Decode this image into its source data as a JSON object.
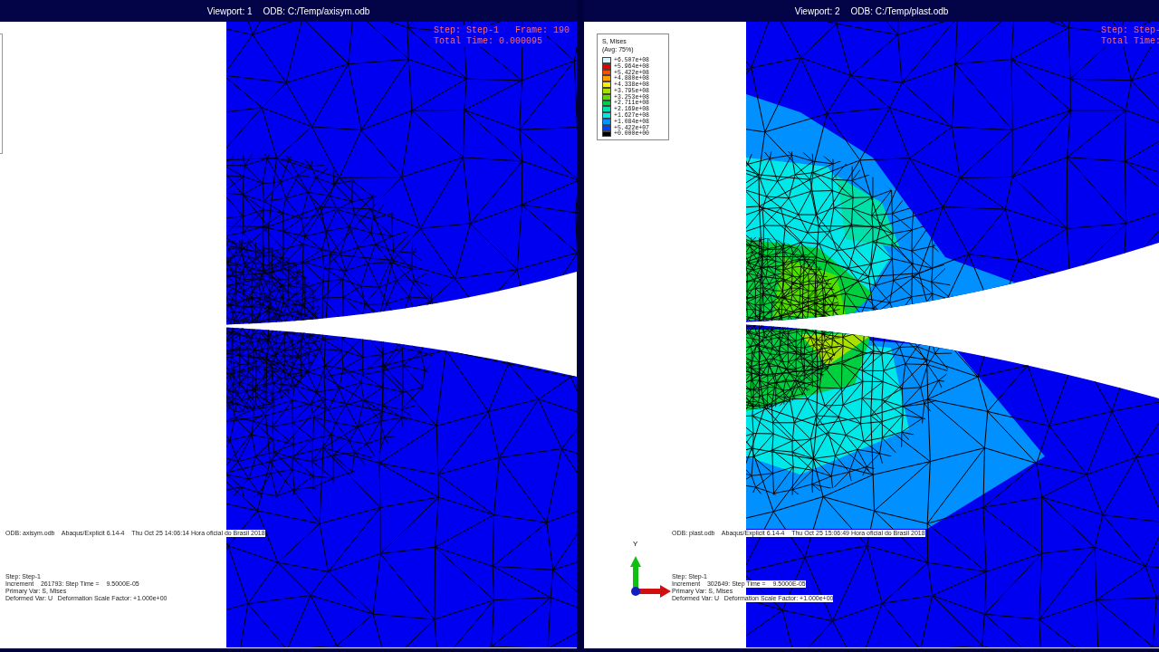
{
  "viewports": [
    {
      "title": "Viewport: 1",
      "odb": "ODB: C:/Temp/axisym.odb",
      "step": "Step: Step-1",
      "frame": "Frame: 190",
      "total_time": "Total Time: 0.000095",
      "contour": false,
      "legend": {
        "kind": "clipped"
      },
      "odb_line": "ODB: axisym.odb    Abaqus/Explicit 6.14-4    Thu Oct 25 14:06:14 Hora oficial do Brasil 2018",
      "info_lines": [
        "Step: Step-1",
        "Increment    261793: Step Time =    9.5000E-05",
        "Primary Var: S, Mises",
        "Deformed Var: U   Deformation Scale Factor: +1.000e+00"
      ]
    },
    {
      "title": "Viewport: 2",
      "odb": "ODB: C:/Temp/plast.odb",
      "step": "Step: Step-",
      "total_time": "Total Time:",
      "contour": true,
      "legend": {
        "kind": "full",
        "title": "S, Mises",
        "subtitle": "(Avg: 75%)",
        "entries": [
          {
            "color": "#d8f4ff",
            "label": "+6.507e+08"
          },
          {
            "color": "#e00000",
            "label": "+5.964e+08"
          },
          {
            "color": "#ff4a00",
            "label": "+5.422e+08"
          },
          {
            "color": "#ff9a00",
            "label": "+4.880e+08"
          },
          {
            "color": "#f4f000",
            "label": "+4.338e+08"
          },
          {
            "color": "#a8e000",
            "label": "+3.795e+08"
          },
          {
            "color": "#50e000",
            "label": "+3.253e+08"
          },
          {
            "color": "#00d040",
            "label": "+2.711e+08"
          },
          {
            "color": "#00e0a8",
            "label": "+2.169e+08"
          },
          {
            "color": "#00e8e8",
            "label": "+1.627e+08"
          },
          {
            "color": "#0098ff",
            "label": "+1.084e+08"
          },
          {
            "color": "#0040ff",
            "label": "+5.422e+07"
          },
          {
            "color": "#000000",
            "label": "+0.000e+00"
          }
        ]
      },
      "odb_line": "ODB: plast.odb    Abaqus/Explicit 6.14-4    Thu Oct 25 15:06:49 Hora oficial do Brasil 2018",
      "info_lines": [
        "Step: Step-1",
        "Increment    302649: Step Time =    9.5000E-05",
        "Primary Var: S, Mises",
        "Deformed Var: U   Deformation Scale Factor: +1.000e+00"
      ],
      "triad": {
        "axis_label": "Y"
      }
    }
  ]
}
